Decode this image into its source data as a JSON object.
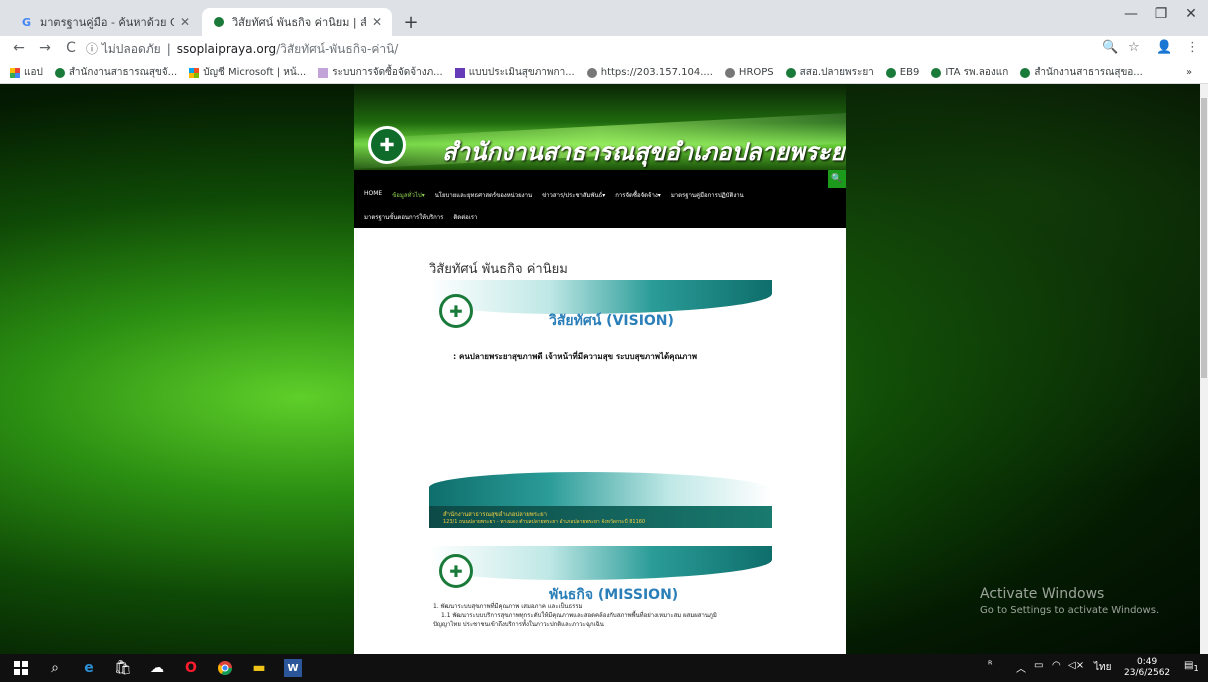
{
  "browser": {
    "tabs": [
      {
        "title": "มาตรฐานคู่มือ - ค้นหาด้วย Google",
        "active": false
      },
      {
        "title": "วิสัยทัศน์ พันธกิจ ค่านิยม | สำนักงานส",
        "active": true
      }
    ],
    "new_tab": "+",
    "window_controls": {
      "minimize": "—",
      "maximize": "❐",
      "close": "✕"
    },
    "nav": {
      "back": "←",
      "forward": "→",
      "reload": "C"
    },
    "address": {
      "security": "ⓘ ไม่ปลอดภัย",
      "separator": "|",
      "host": "ssoplaipraya.org",
      "path": "/วิสัยทัศน์-พันธกิจ-ค่านิ/"
    },
    "toolbar_icons": {
      "zoom": "🔍",
      "star": "☆",
      "profile": "👤",
      "menu": "⋮"
    },
    "bookmarks": [
      "แอป",
      "สำนักงานสาธารณสุขจั...",
      "บัญชี Microsoft | หน้...",
      "ระบบการจัดซื้อจัดจ้างภ...",
      "แบบประเมินสุขภาพกา...",
      "https://203.157.104....",
      "HROPS",
      "สสอ.ปลายพระยา",
      "EB9",
      "ITA รพ.ลองแก",
      "สำนักงานสาธารณสุขอ..."
    ],
    "bookmarks_more": "»"
  },
  "site": {
    "title": "สำนักงานสาธารณสุขอำเภอปลายพระยา",
    "search_icon": "🔍",
    "nav_row1": [
      "HOME",
      "ข้อมูลทั่วไป▾",
      "นโยบายและยุทธศาสตร์ของหน่วยงาน",
      "ข่าวสาร/ประชาสัมพันธ์▾",
      "การจัดซื้อจัดจ้าง▾",
      "มาตรฐานคู่มือการปฏิบัติงาน"
    ],
    "nav_row2": [
      "มาตรฐานขั้นตอนการให้บริการ",
      "ติดต่อเรา"
    ],
    "page_title": "วิสัยทัศน์ พันธกิจ ค่านิยม",
    "vision": {
      "heading": "วิสัยทัศน์ (VISION)",
      "text": ":  คนปลายพระยาสุขภาพดี  เจ้าหน้าที่มีความสุข  ระบบสุขภาพได้คุณภาพ",
      "footer_line1": "สำนักงานสาธารณสุขอำเภอปลายพระยา",
      "footer_line2": "123/1 ถนนปลายพระยา - ทางแดง ตำบลปลายพระยา อำเภอปลายพระยา จังหวัดกระบี่ 81160"
    },
    "mission": {
      "heading": "พันธกิจ (MISSION)",
      "line1": "1. พัฒนาระบบสุขภาพที่มีคุณภาพ เสมอภาค และเป็นธรรม",
      "line2": "1.1 พัฒนาระบบบริการสุขภาพทุกระดับให้มีคุณภาพและสอดคล้องกับสภาพพื้นที่อย่างเหมาะสม ผสมผสานภูมิ",
      "line3": "ปัญญาไทย ประชาชนเข้าถึงบริการทั้งในภาวะปกติและภาวะฉุกเฉิน"
    }
  },
  "activation": {
    "title": "Activate Windows",
    "subtitle": "Go to Settings to activate Windows."
  },
  "taskbar": {
    "tray_text": "ไทย",
    "time": "0:49",
    "date": "23/6/2562",
    "notif_count": "1"
  }
}
